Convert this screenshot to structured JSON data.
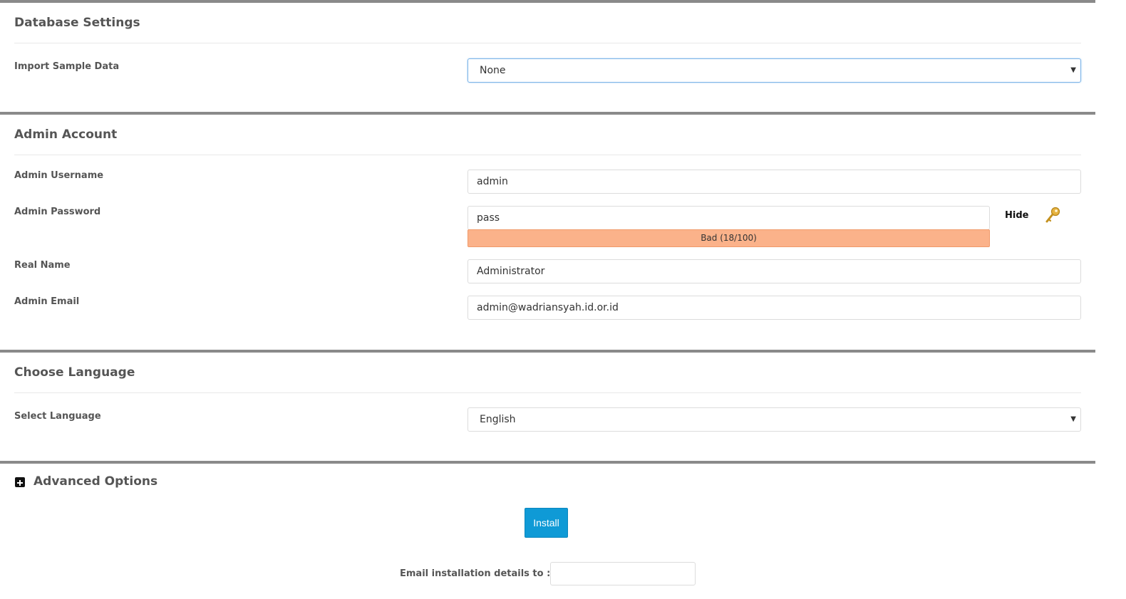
{
  "database": {
    "title": "Database Settings",
    "import_label": "Import Sample Data",
    "import_value": "None"
  },
  "admin": {
    "title": "Admin Account",
    "username_label": "Admin Username",
    "username_value": "admin",
    "password_label": "Admin Password",
    "password_value": "pass",
    "strength_text": "Bad (18/100)",
    "strength_percent": 18,
    "hide_label": "Hide",
    "realname_label": "Real Name",
    "realname_value": "Administrator",
    "email_label": "Admin Email",
    "email_value": "admin@wadriansyah.id.or.id"
  },
  "language": {
    "title": "Choose Language",
    "select_label": "Select Language",
    "select_value": "English"
  },
  "advanced": {
    "title": "Advanced Options",
    "toggle_icon": "plus-square-icon"
  },
  "install": {
    "button_label": "Install",
    "email_details_label": "Email installation details to :",
    "email_details_value": ""
  },
  "colors": {
    "section_border": "#8a8a8a",
    "strength_bad": "#fbb28a",
    "install_button": "#0f9ad6"
  }
}
